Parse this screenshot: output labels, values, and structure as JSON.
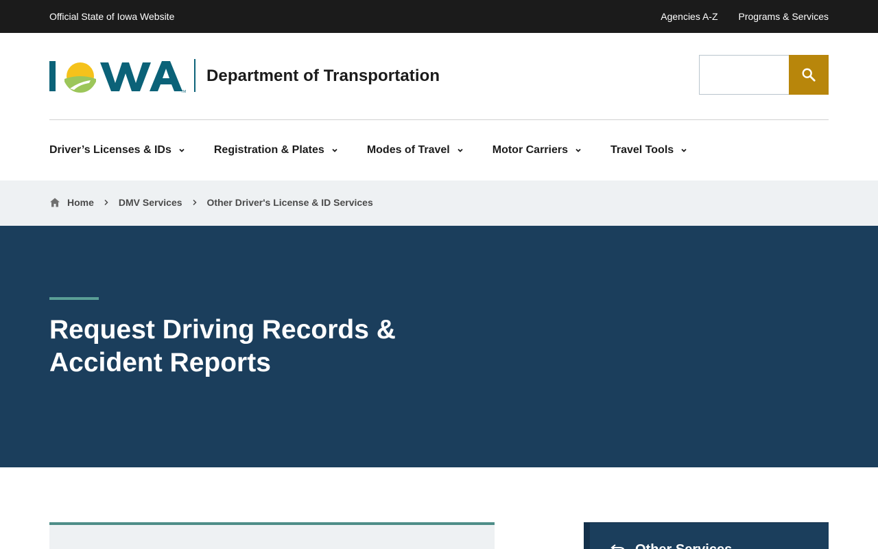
{
  "topbar": {
    "official": "Official State of Iowa Website",
    "links": [
      "Agencies A-Z",
      "Programs & Services"
    ]
  },
  "header": {
    "logo_text": "IOWA",
    "department": "Department of Transportation",
    "search_placeholder": "",
    "search_icon": "search-icon"
  },
  "nav": {
    "items": [
      "Driver’s Licenses & IDs",
      "Registration & Plates",
      "Modes of Travel",
      "Motor Carriers",
      "Travel Tools"
    ]
  },
  "breadcrumb": {
    "home": "Home",
    "items": [
      "DMV Services",
      "Other Driver's License & ID Services"
    ]
  },
  "hero": {
    "title": "Request Driving Records & Accident Reports"
  },
  "sidebar": {
    "title": "Other Services"
  },
  "colors": {
    "topbar": "#1b1b1b",
    "hero": "#1b3e5c",
    "accent_teal": "#5a9e96",
    "search_button": "#b8860b",
    "logo_teal": "#0b6278",
    "breadcrumb_bg": "#eef1f3"
  }
}
